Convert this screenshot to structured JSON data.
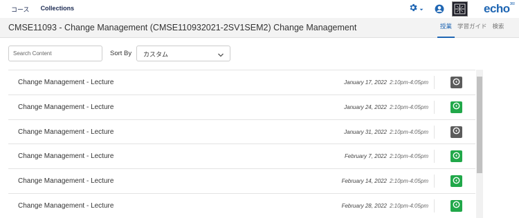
{
  "topnav": {
    "courses": "コース",
    "collections": "Collections"
  },
  "brand": {
    "logo_text": "echo",
    "logo_sup": "360"
  },
  "course": {
    "title": "CMSE11093 - Change Management (CMSE110932021-2SV1SEM2) Change Management"
  },
  "tabs": [
    {
      "label": "授業",
      "active": true
    },
    {
      "label": "学習ガイド",
      "active": false
    },
    {
      "label": "検索",
      "active": false
    }
  ],
  "search": {
    "placeholder": "Search Content",
    "value": ""
  },
  "sort": {
    "label": "Sort By",
    "value": "カスタム"
  },
  "lectures": [
    {
      "name": "Change Management - Lecture",
      "date": "January 17, 2022",
      "time": "2:10pm-4:05pm",
      "status": "gray"
    },
    {
      "name": "Change Management - Lecture",
      "date": "January 24, 2022",
      "time": "2:10pm-4:05pm",
      "status": "green"
    },
    {
      "name": "Change Management - Lecture",
      "date": "January 31, 2022",
      "time": "2:10pm-4:05pm",
      "status": "gray"
    },
    {
      "name": "Change Management - Lecture",
      "date": "February 7, 2022",
      "time": "2:10pm-4:05pm",
      "status": "green"
    },
    {
      "name": "Change Management - Lecture",
      "date": "February 14, 2022",
      "time": "2:10pm-4:05pm",
      "status": "green"
    },
    {
      "name": "Change Management - Lecture",
      "date": "February 28, 2022",
      "time": "2:10pm-4:05pm",
      "status": "green"
    }
  ],
  "colors": {
    "accent": "#1f66b3",
    "green": "#21a84a",
    "gray": "#5c5c5c",
    "gear": "#1f66b3"
  },
  "icons": {
    "settings": "gear-icon",
    "user": "user-icon",
    "play": "play-circle-icon",
    "chevron": "chevron-down-icon"
  }
}
